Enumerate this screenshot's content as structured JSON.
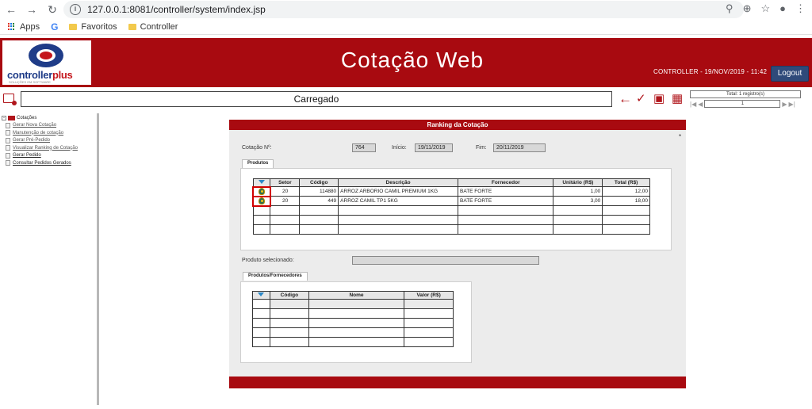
{
  "browser": {
    "url": "127.0.0.1:8081/controller/system/index.jsp",
    "bookmarks": [
      {
        "label": "Apps"
      },
      {
        "label": "Favoritos"
      },
      {
        "label": "Controller"
      }
    ]
  },
  "header": {
    "logo_text": "controller",
    "logo_plus": "plus",
    "logo_sub": "SOLUÇÕES EM SOFTWARE",
    "title": "Cotação Web",
    "info": "CONTROLLER - 19/NOV/2019 - 11:42",
    "logout_label": "Logout"
  },
  "toolbar": {
    "status": "Carregado",
    "pager_total": "Total: 1 registro(s)",
    "pager_page": "1"
  },
  "sidebar": {
    "root_label": "Cotações",
    "items": [
      {
        "label": "Gerar Nova Cotação"
      },
      {
        "label": "Manutenção de cotação"
      },
      {
        "label": "Gerar Pré-Pedido"
      },
      {
        "label": "Visualizar Ranking de Cotação"
      },
      {
        "label": "Gerar Pedido"
      },
      {
        "label": "Consultar Pedidos Gerados"
      }
    ]
  },
  "panel": {
    "title": "Ranking da Cotação",
    "asterisk": "*",
    "cotacao_label": "Cotação Nº:",
    "cotacao_value": "764",
    "inicio_label": "Início:",
    "inicio_value": "19/11/2019",
    "fim_label": "Fim:",
    "fim_value": "20/11/2019",
    "tab_produtos": "Produtos",
    "produtos_headers": [
      "Setor",
      "Código",
      "Descrição",
      "Fornecedor",
      "Unitário (R$)",
      "Total (R$)"
    ],
    "produtos_rows": [
      {
        "setor": "20",
        "codigo": "114880",
        "descricao": "ARROZ ARBORIO CAMIL PREMIUM  1KG",
        "fornecedor": "BATE FORTE",
        "unitario": "1,00",
        "total": "12,00"
      },
      {
        "setor": "20",
        "codigo": "449",
        "descricao": "ARROZ CAMIL TP1 5KG",
        "fornecedor": "BATE FORTE",
        "unitario": "3,00",
        "total": "18,00"
      }
    ],
    "produto_selecionado_label": "Produto selecionado:",
    "produto_selecionado_value": "",
    "tab_prod_fornec": "Produtos/Fornecedores",
    "fornec_headers": [
      "Código",
      "Nome",
      "Valor (R$)"
    ]
  }
}
